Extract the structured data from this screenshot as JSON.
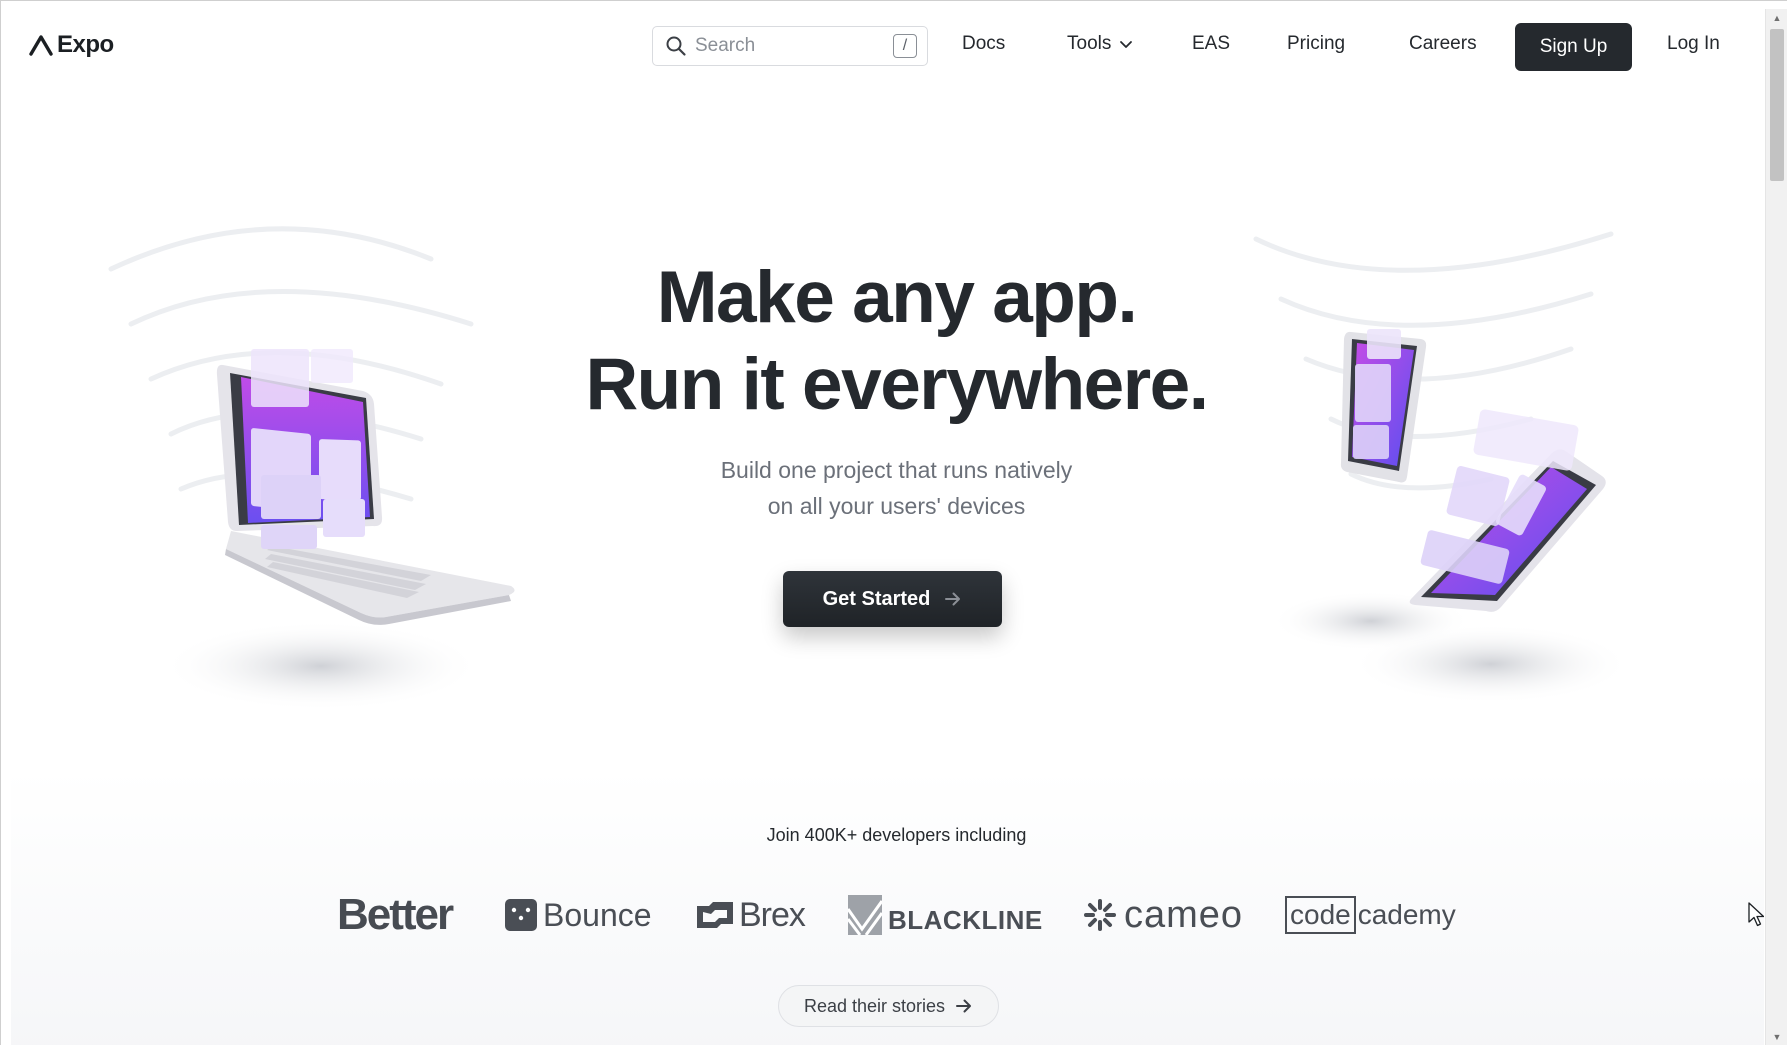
{
  "nav": {
    "logo_text": "Expo",
    "search_placeholder": "Search",
    "search_shortcut": "/",
    "links": {
      "docs": "Docs",
      "tools": "Tools",
      "eas": "EAS",
      "pricing": "Pricing",
      "careers": "Careers"
    },
    "signup_label": "Sign Up",
    "login_label": "Log In"
  },
  "hero": {
    "title_line1": "Make any app.",
    "title_line2": "Run it everywhere.",
    "subtitle_line1": "Build one project that runs natively",
    "subtitle_line2": "on all your users' devices",
    "cta_label": "Get Started"
  },
  "customers": {
    "heading": "Join 400K+ developers including",
    "brands": {
      "better": "Better",
      "bounce": "Bounce",
      "brex": "Brex",
      "blackline": "BLACKLINE",
      "cameo": "cameo",
      "codecademy_boxed": "code",
      "codecademy_rest": "cademy"
    },
    "stories_label": "Read their stories"
  },
  "colors": {
    "text_dark": "#25292e",
    "muted": "#6b7079",
    "accent_purple": "#8b3cf0",
    "accent_magenta": "#c63ee6",
    "brand_gray": "#4a4e55"
  },
  "icons": {
    "logo": "expo-logo-icon",
    "search": "search-icon",
    "tools_chevron": "chevron-down-icon",
    "cta_arrow": "arrow-right-icon",
    "stories_arrow": "arrow-right-icon",
    "cursor": "mouse-cursor-icon"
  }
}
